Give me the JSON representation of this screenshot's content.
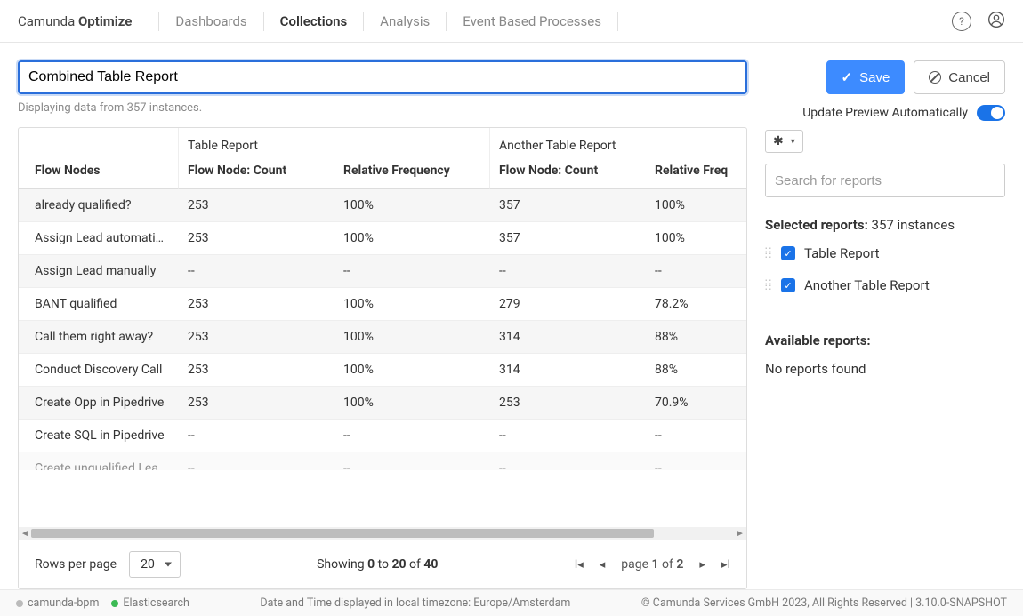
{
  "brand": {
    "a": "Camunda ",
    "b": "Optimize"
  },
  "nav": {
    "items": [
      {
        "label": "Dashboards",
        "active": false
      },
      {
        "label": "Collections",
        "active": true
      },
      {
        "label": "Analysis",
        "active": false
      },
      {
        "label": "Event Based Processes",
        "active": false
      }
    ]
  },
  "title": {
    "value": "Combined Table Report",
    "subnote": "Displaying data from 357 instances."
  },
  "buttons": {
    "save": "Save",
    "cancel": "Cancel"
  },
  "preview": {
    "label": "Update Preview Automatically",
    "on": true
  },
  "table": {
    "groupHeaders": {
      "a": "",
      "b": "Table Report",
      "c": "Another Table Report"
    },
    "headers": {
      "flowNodes": "Flow Nodes",
      "count1": "Flow Node: Count",
      "rel1": "Relative Frequency",
      "count2": "Flow Node: Count",
      "rel2": "Relative Freq"
    },
    "rows": [
      {
        "name": "already qualified?",
        "c1": "253",
        "r1": "100%",
        "c2": "357",
        "r2": "100%"
      },
      {
        "name": "Assign Lead automatic...",
        "c1": "253",
        "r1": "100%",
        "c2": "357",
        "r2": "100%"
      },
      {
        "name": "Assign Lead manually",
        "c1": "--",
        "r1": "--",
        "c2": "--",
        "r2": "--"
      },
      {
        "name": "BANT qualified",
        "c1": "253",
        "r1": "100%",
        "c2": "279",
        "r2": "78.2%"
      },
      {
        "name": "Call them right away?",
        "c1": "253",
        "r1": "100%",
        "c2": "314",
        "r2": "88%"
      },
      {
        "name": "Conduct Discovery Call",
        "c1": "253",
        "r1": "100%",
        "c2": "314",
        "r2": "88%"
      },
      {
        "name": "Create Opp in Pipedrive",
        "c1": "253",
        "r1": "100%",
        "c2": "253",
        "r2": "70.9%"
      },
      {
        "name": "Create SQL in Pipedrive",
        "c1": "--",
        "r1": "--",
        "c2": "--",
        "r2": "--"
      },
      {
        "name": "Create unqualified Lea",
        "c1": "--",
        "r1": "--",
        "c2": "--",
        "r2": "--"
      }
    ]
  },
  "pagination": {
    "rowsPerPageLabel": "Rows per page",
    "rowsPerPageValue": "20",
    "showing_prefix": "Showing ",
    "showing_from": "0",
    "showing_to_word": " to ",
    "showing_to": "20",
    "showing_of_word": " of ",
    "showing_total": "40",
    "page_word": "page ",
    "page_current": "1",
    "page_of_word": " of ",
    "page_total": "2"
  },
  "sidebar": {
    "search_placeholder": "Search for reports",
    "selected_label": "Selected reports:",
    "selected_count": " 357 instances",
    "selected": [
      {
        "label": "Table Report",
        "checked": true
      },
      {
        "label": "Another Table Report",
        "checked": true
      }
    ],
    "available_label": "Available reports:",
    "available_none": "No reports found"
  },
  "footer": {
    "engine": "camunda-bpm",
    "elastic": "Elasticsearch",
    "tz": "Date and Time displayed in local timezone: Europe/Amsterdam",
    "copyright": "© Camunda Services GmbH 2023, All Rights Reserved | 3.10.0-SNAPSHOT"
  }
}
